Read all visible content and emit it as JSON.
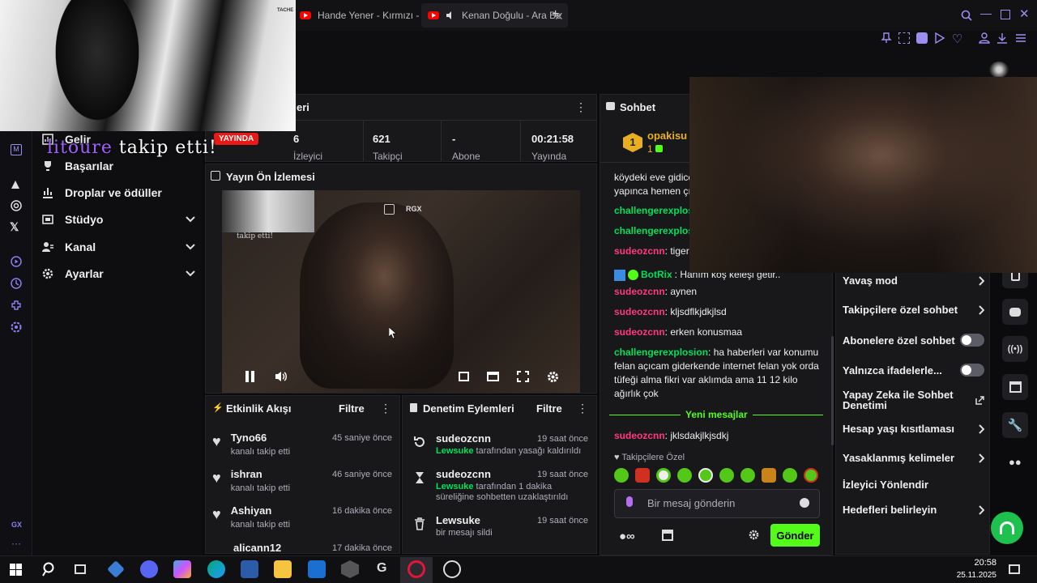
{
  "browser": {
    "tabs": [
      {
        "label": "Hande Yener - Kırmızı - Y"
      },
      {
        "label": "Kenan Doğulu - Ara Be"
      }
    ],
    "new_tab": "+",
    "tache_label": "TACHE"
  },
  "overlay": {
    "follow_user": "litoure",
    "follow_text": "takip etti!",
    "stream_tag": "RGX"
  },
  "sidebar": {
    "items": [
      {
        "label": "Gelir"
      },
      {
        "label": "Başarılar"
      },
      {
        "label": "Droplar ve ödüller"
      },
      {
        "label": "Stüdyo"
      },
      {
        "label": "Kanal"
      },
      {
        "label": "Ayarlar"
      }
    ],
    "gx_label": "GX"
  },
  "stats_panel": {
    "title_fragment": "eri",
    "live_badge": "YAYINDA",
    "stats": [
      {
        "value": "6",
        "label": "İzleyici"
      },
      {
        "value": "621",
        "label": "Takipçi"
      },
      {
        "value": "-",
        "label": "Abone"
      },
      {
        "value": "00:21:58",
        "label": "Yayında"
      }
    ]
  },
  "preview": {
    "title": "Yayın Ön İzlemesi",
    "tag": "RGX"
  },
  "activity": {
    "title": "Etkinlik Akışı",
    "filter": "Filtre",
    "items": [
      {
        "name": "Tyno66",
        "sub": "kanalı takip etti",
        "time": "45 saniye önce"
      },
      {
        "name": "ishran",
        "sub": "kanalı takip etti",
        "time": "46 saniye önce"
      },
      {
        "name": "Ashiyan",
        "sub": "kanalı takip etti",
        "time": "16 dakika önce"
      },
      {
        "name": "alicann12",
        "sub": "",
        "time": "17 dakika önce"
      }
    ]
  },
  "moderation": {
    "title": "Denetim Eylemleri",
    "filter": "Filtre",
    "items": [
      {
        "name": "sudeozcnn",
        "time": "19 saat önce",
        "actor": "Lewsuke",
        "text": "tarafından yasağı kaldırıldı"
      },
      {
        "name": "sudeozcnn",
        "time": "19 saat önce",
        "actor": "Lewsuke",
        "text": "tarafından 1 dakika süreliğine sohbetten uzaklaştırıldı"
      },
      {
        "name": "Lewsuke",
        "time": "19 saat önce",
        "actor": "",
        "text": "bir mesajı sildi"
      }
    ]
  },
  "chat": {
    "title": "Sohbet",
    "top_user": {
      "name": "opakisu",
      "count": "1",
      "rank": "1"
    },
    "messages": [
      {
        "user": "",
        "text": "köydeki eve gidice"
      },
      {
        "user": "",
        "text": "yapınca hemen çık"
      },
      {
        "user": "challengerexplosi",
        "text": ""
      },
      {
        "user": "challengerexplosi",
        "text": ""
      },
      {
        "user": "sudeozcnn",
        "text": ": tigeru"
      },
      {
        "user": "BotRix",
        "text": ": Hanım koş keleşi getir.."
      },
      {
        "user": "sudeozcnn",
        "text": ": aynen"
      },
      {
        "user": "sudeozcnn",
        "text": ": kljsdflkjdkjlsd"
      },
      {
        "user": "sudeozcnn",
        "text": ": erken konusmaa"
      },
      {
        "user": "challengerexplosion",
        "text": ": ha haberleri var konumu felan açıcam giderkende internet felan yok orda tüfeği alma fikri var aklımda ama 11 12 kilo ağırlık çok"
      }
    ],
    "new_messages": "Yeni mesajlar",
    "last": {
      "user": "sudeozcnn",
      "text": ": jklsdakjlkjsdkj"
    },
    "emote_label": "Takipçilere Özel",
    "input_placeholder": "Bir mesaj gönderin",
    "send": "Gönder"
  },
  "chat_settings": {
    "items": [
      {
        "label": "Yavaş mod",
        "kind": "arrow"
      },
      {
        "label": "Takipçilere özel sohbet",
        "kind": "arrow"
      },
      {
        "label": "Abonelere özel sohbet",
        "kind": "toggle"
      },
      {
        "label": "Yalnızca ifadelerle...",
        "kind": "toggle"
      },
      {
        "label": "Yapay Zeka ile Sohbet Denetimi",
        "kind": "external"
      },
      {
        "label": "Hesap yaşı kısıtlaması",
        "kind": "arrow"
      },
      {
        "label": "Yasaklanmış kelimeler",
        "kind": "arrow"
      },
      {
        "label": "İzleyici Yönlendir",
        "kind": "none"
      },
      {
        "label": "Hedefleri belirleyin",
        "kind": "arrow"
      }
    ]
  },
  "ticker": {
    "user": "sudeozcnn",
    "text": "jklsdakjlkjsdkj"
  },
  "taskbar": {
    "time": "20:58",
    "date": "25.11.2025"
  },
  "colors": {
    "accent_green": "#53fc18",
    "live_red": "#e91916",
    "chat_pink": "#ff3a7a",
    "chat_green": "#00e15b",
    "brand_purple": "#9a8ff0"
  }
}
